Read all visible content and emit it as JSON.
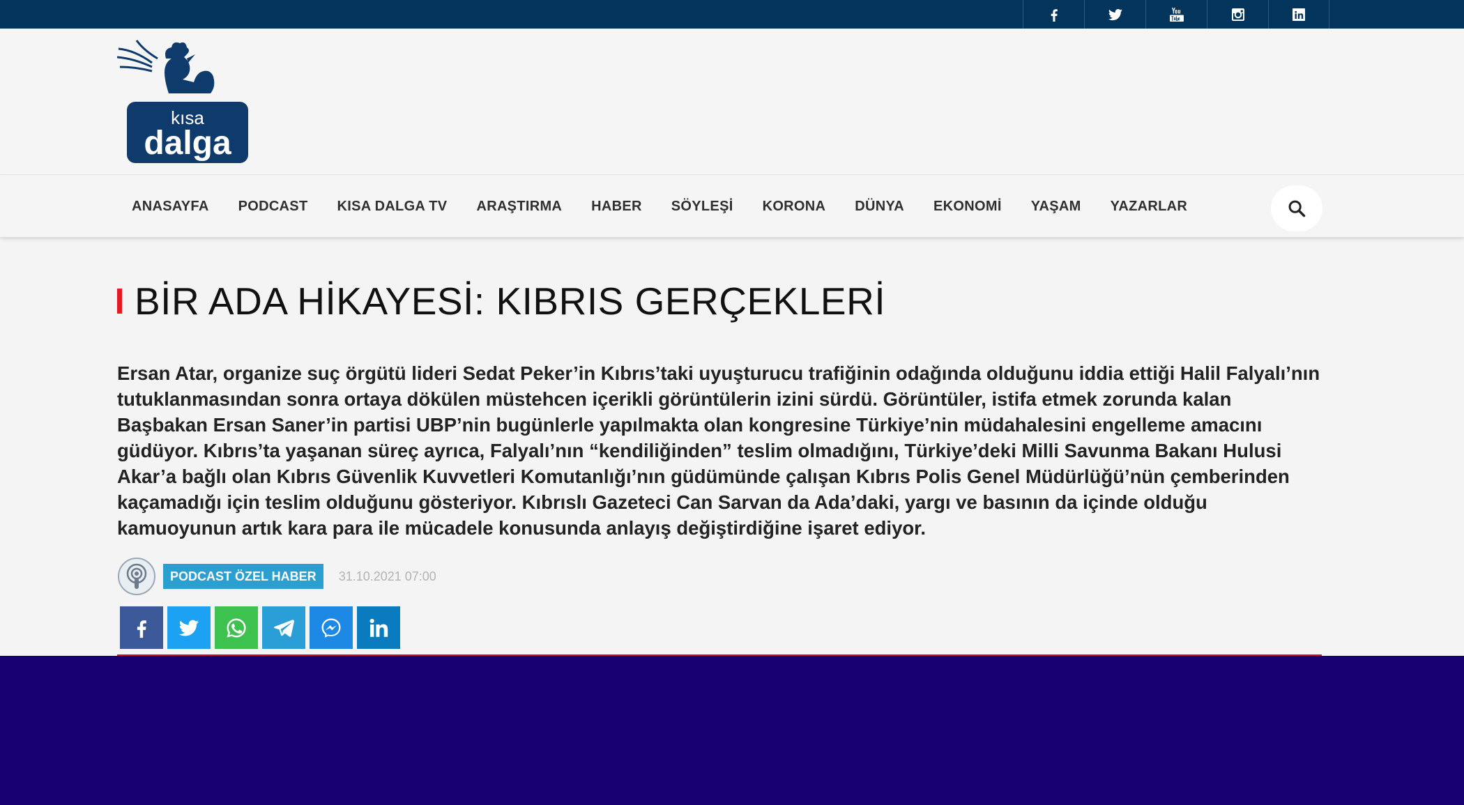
{
  "social_top": [
    {
      "icon": "facebook-icon",
      "label": "f"
    },
    {
      "icon": "twitter-icon",
      "label": "twitter"
    },
    {
      "icon": "youtube-icon",
      "label": "You Tube"
    },
    {
      "icon": "instagram-icon",
      "label": "instagram"
    },
    {
      "icon": "linkedin-icon",
      "label": "in"
    }
  ],
  "logo": {
    "line1": "kısa",
    "line2": "dalga"
  },
  "nav": {
    "items": [
      "ANASAYFA",
      "PODCAST",
      "KISA DALGA TV",
      "ARAŞTIRMA",
      "HABER",
      "SÖYLEŞİ",
      "KORONA",
      "DÜNYA",
      "EKONOMİ",
      "YAŞAM",
      "YAZARLAR"
    ],
    "search_icon": "search-icon"
  },
  "article": {
    "title": "BİR ADA HİKAYESİ: KIBRIS GERÇEKLERİ",
    "summary": "Ersan Atar, organize suç örgütü lideri Sedat Peker’in Kıbrıs’taki uyuşturucu trafiğinin odağında olduğunu iddia ettiği Halil Falyalı’nın tutuklanmasından sonra ortaya dökülen müstehcen içerikli görüntülerin izini sürdü. Görüntüler, istifa etmek zorunda kalan Başbakan Ersan Saner’in partisi UBP’nin bugünlerle yapılmakta olan kongresine Türkiye’nin müdahalesini engelleme amacını güdüyor. Kıbrıs’ta yaşanan süreç ayrıca, Falyalı’nın “kendiliğinden” teslim olmadığını, Türkiye’deki Milli Savunma Bakanı Hulusi Akar’a bağlı olan Kıbrıs Güvenlik Kuvvetleri Komutanlığı’nın güdümünde çalışan Kıbrıs Polis Genel Müdürlüğü’nün çemberinden kaçamadığı için teslim olduğunu gösteriyor. Kıbrıslı Gazeteci Can Sarvan da Ada’daki, yargı ve basının da içinde olduğu kamuoyunun artık kara para ile mücadele konusunda anlayış değiştirdiğine işaret ediyor.",
    "category_tag": "PODCAST ÖZEL HABER",
    "date": "31.10.2021 07:00"
  },
  "share_buttons": [
    {
      "name": "facebook",
      "color": "#3b5998"
    },
    {
      "name": "twitter",
      "color": "#1da1f2"
    },
    {
      "name": "whatsapp",
      "color": "#3dc24f"
    },
    {
      "name": "telegram",
      "color": "#2a9ed6"
    },
    {
      "name": "messenger",
      "color": "#1e88e5"
    },
    {
      "name": "linkedin",
      "color": "#0a7bbf"
    }
  ],
  "colors": {
    "topbar": "#03345c",
    "accent_red": "#e51b24",
    "tag_blue": "#2b9fd0",
    "footer": "#170070",
    "logo_blue": "#0f3b6c"
  }
}
